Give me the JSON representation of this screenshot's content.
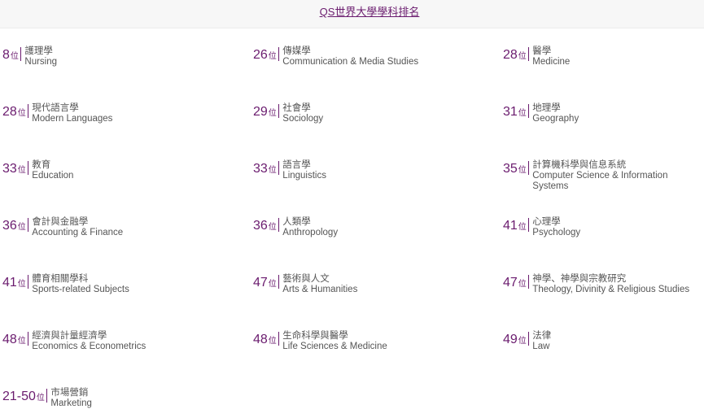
{
  "header": {
    "link_label": "QS世界大學學科排名"
  },
  "rank_unit": "位",
  "subjects": [
    {
      "rank": "8",
      "zh": "護理學",
      "en": "Nursing"
    },
    {
      "rank": "26",
      "zh": "傳媒學",
      "en": "Communication & Media Studies"
    },
    {
      "rank": "28",
      "zh": "醫學",
      "en": "Medicine"
    },
    {
      "rank": "28",
      "zh": "現代語言學",
      "en": "Modern Languages"
    },
    {
      "rank": "29",
      "zh": "社會學",
      "en": "Sociology"
    },
    {
      "rank": "31",
      "zh": "地理學",
      "en": "Geography"
    },
    {
      "rank": "33",
      "zh": "教育",
      "en": "Education"
    },
    {
      "rank": "33",
      "zh": "語言學",
      "en": "Linguistics"
    },
    {
      "rank": "35",
      "zh": "計算機科學與信息系統",
      "en": "Computer Science & Information Systems"
    },
    {
      "rank": "36",
      "zh": "會計與金融學",
      "en": "Accounting & Finance"
    },
    {
      "rank": "36",
      "zh": "人類學",
      "en": "Anthropology"
    },
    {
      "rank": "41",
      "zh": "心理學",
      "en": "Psychology"
    },
    {
      "rank": "41",
      "zh": "體育相關學科",
      "en": "Sports-related Subjects"
    },
    {
      "rank": "47",
      "zh": "藝術與人文",
      "en": "Arts & Humanities"
    },
    {
      "rank": "47",
      "zh": "神學、神學與宗教研究",
      "en": "Theology, Divinity & Religious Studies"
    },
    {
      "rank": "48",
      "zh": "經濟與計量經濟學",
      "en": "Economics & Econometrics"
    },
    {
      "rank": "48",
      "zh": "生命科學與醫學",
      "en": "Life Sciences & Medicine"
    },
    {
      "rank": "49",
      "zh": "法律",
      "en": "Law"
    },
    {
      "rank": "21-50",
      "zh": "市場營銷",
      "en": "Marketing"
    }
  ]
}
